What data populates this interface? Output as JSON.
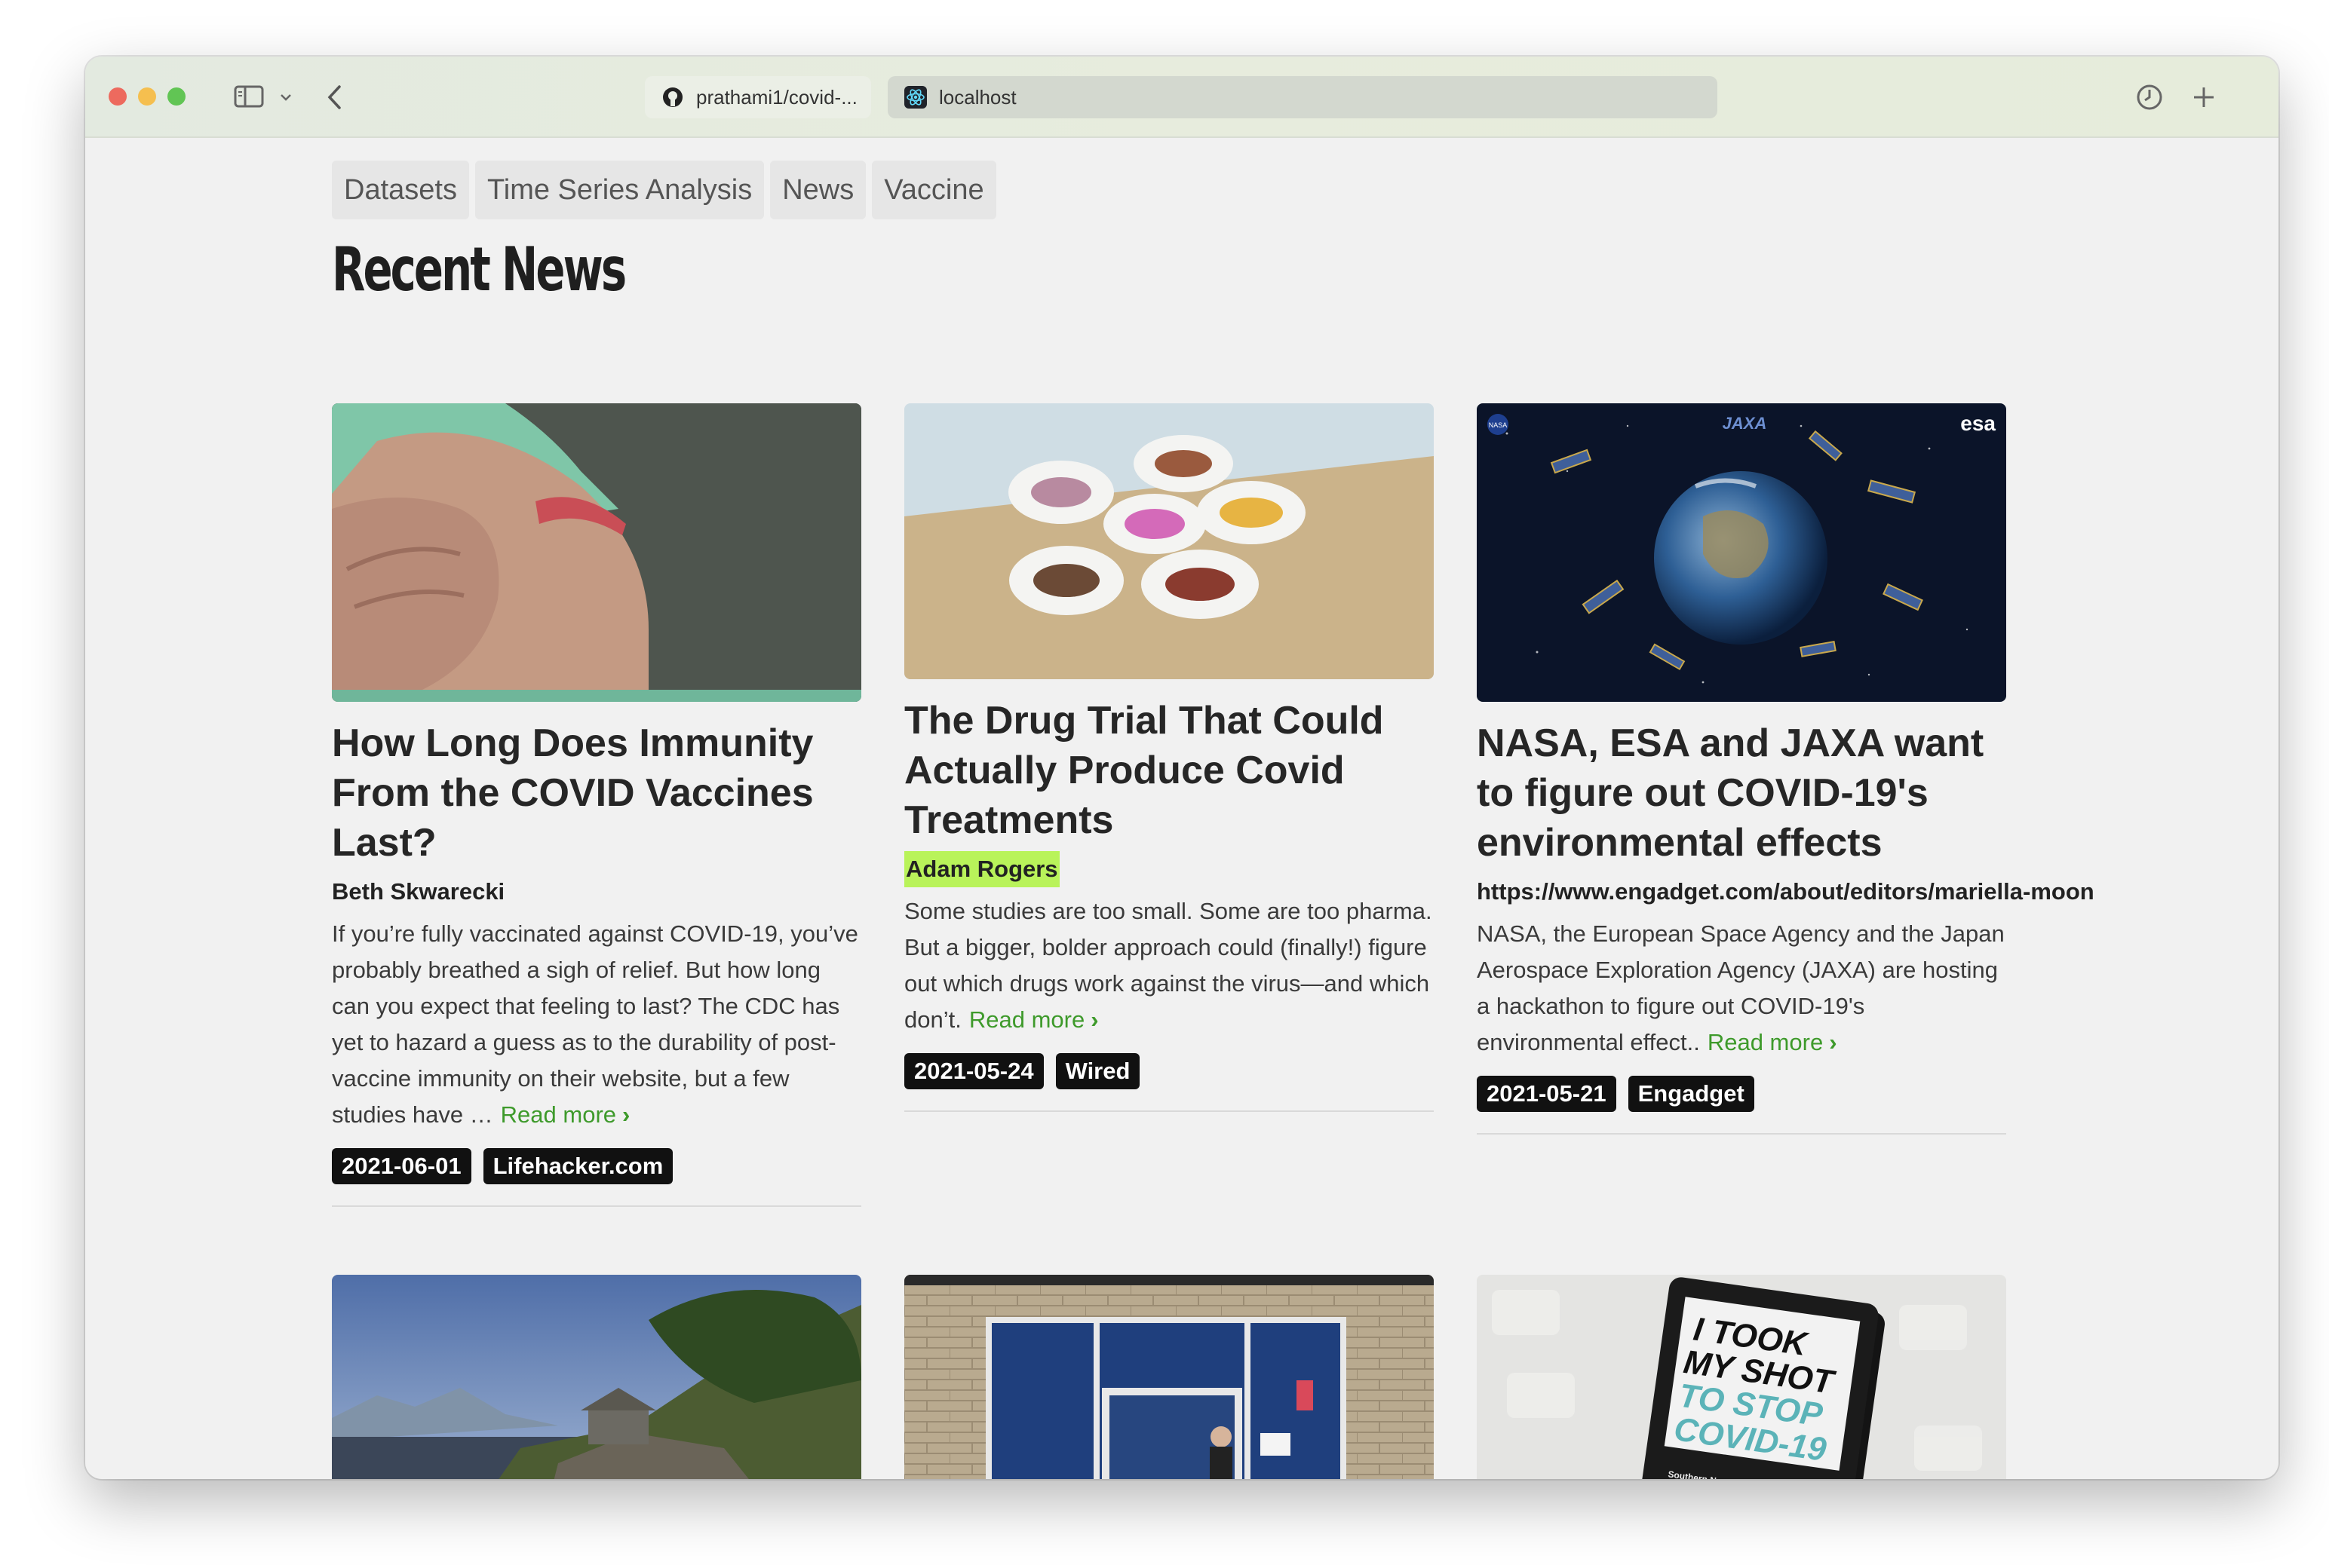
{
  "browser": {
    "tab1_title": "prathami1/covid-...",
    "tab2_title": "localhost"
  },
  "nav": {
    "items": [
      "Datasets",
      "Time Series Analysis",
      "News",
      "Vaccine"
    ]
  },
  "page": {
    "title": "Recent News"
  },
  "articles": [
    {
      "title": "How Long Does Immunity From the COVID Vaccines Last?",
      "author": "Beth Skwarecki",
      "author_highlight": false,
      "description": "If you’re fully vaccinated against COVID-19, you’ve probably breathed a sigh of relief. But how long can you expect that feeling to last? The CDC has yet to hazard a guess as to the durability of post-vaccine immunity on their website, but a few studies have …",
      "read_more": "Read more",
      "date": "2021-06-01",
      "source": "Lifehacker.com",
      "image": "arm-bandage-photo"
    },
    {
      "title": "The Drug Trial That Could Actually Produce Covid Treatments",
      "author": "Adam Rogers",
      "author_highlight": true,
      "description": "Some studies are too small. Some are too pharma. But a bigger, bolder approach could (finally!) figure out which drugs work against the virus—and which don’t.",
      "read_more": "Read more",
      "date": "2021-05-24",
      "source": "Wired",
      "image": "pill-bowls-photo"
    },
    {
      "title": "NASA, ESA and JAXA want to figure out COVID-19's environmental effects",
      "author": "https://www.engadget.com/about/editors/mariella-moon",
      "author_highlight": false,
      "description": "NASA, the European Space Agency and the Japan Aerospace Exploration Agency (JAXA) are hosting a hackathon to figure out COVID-19's environmental effect..",
      "read_more": "Read more",
      "date": "2021-05-21",
      "source": "Engadget",
      "image": "earth-satellites-photo",
      "image_labels": {
        "nasa": "NASA",
        "jaxa": "JAXA",
        "esa": "esa"
      }
    }
  ],
  "articles_row2": [
    {
      "image": "landscape-render-photo"
    },
    {
      "image": "brick-window-photo"
    },
    {
      "image": "vaccine-sticker-photo",
      "sticker_text": [
        "I TOOK",
        "MY SHOT",
        "TO STOP",
        "COVID-19"
      ],
      "sticker_footer": "Southern Nevada Health District"
    }
  ],
  "colors": {
    "accent_link": "#3e9a2b",
    "author_highlight": "#b9f35a",
    "badge_bg": "#111111",
    "page_bg": "#f1f1f1"
  }
}
